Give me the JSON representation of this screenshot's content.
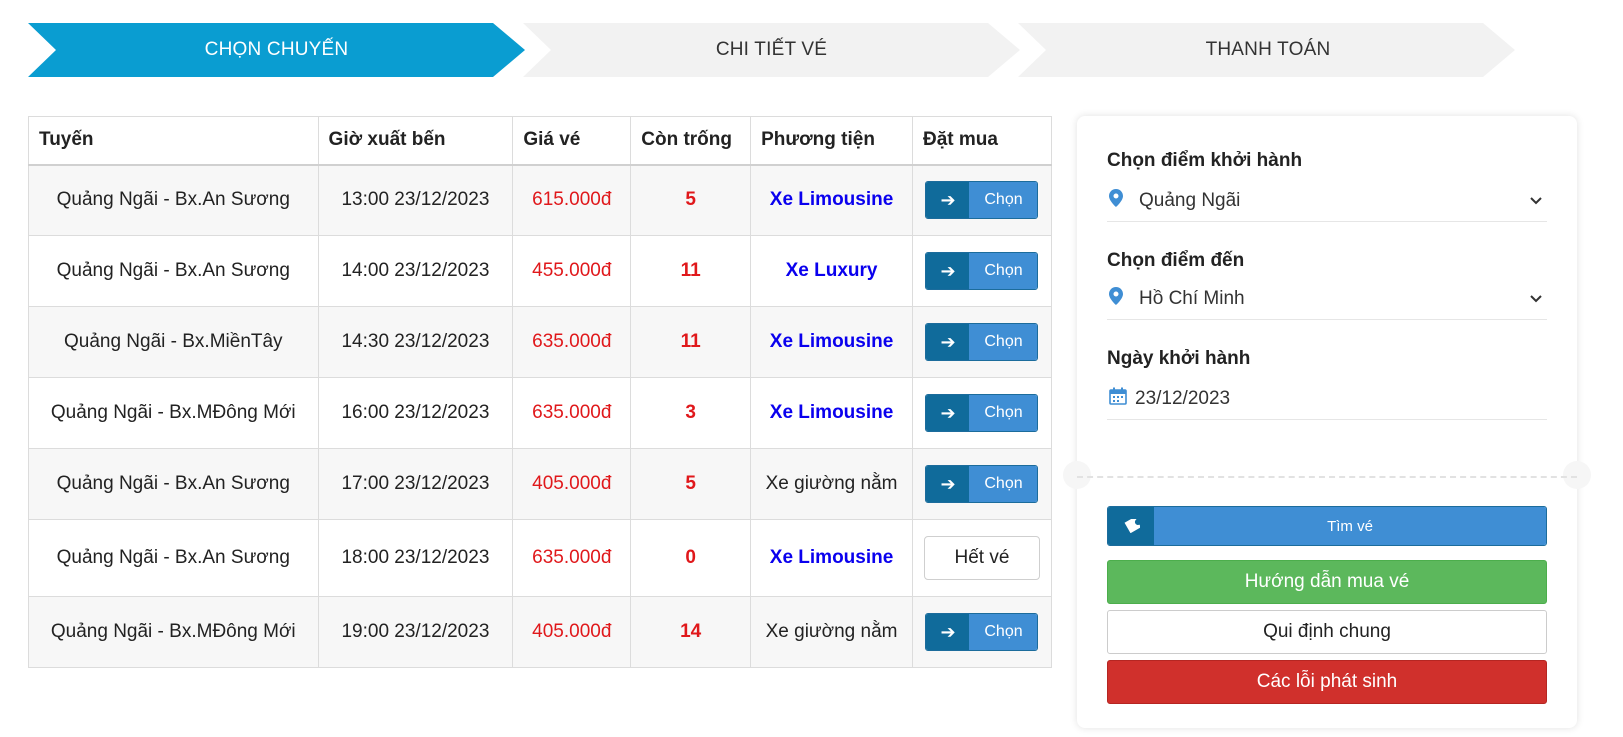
{
  "steps": [
    "CHỌN CHUYẾN",
    "CHI TIẾT VÉ",
    "THANH TOÁN"
  ],
  "table": {
    "headers": [
      "Tuyến",
      "Giờ xuất bến",
      "Giá vé",
      "Còn trống",
      "Phương tiện",
      "Đặt mua"
    ],
    "rows": [
      {
        "route": "Quảng Ngãi - Bx.An Sương",
        "time": "13:00 23/12/2023",
        "price": "615.000đ",
        "seats": "5",
        "vehicle": "Xe Limousine",
        "action": "Chọn"
      },
      {
        "route": "Quảng Ngãi - Bx.An Sương",
        "time": "14:00 23/12/2023",
        "price": "455.000đ",
        "seats": "11",
        "vehicle": "Xe Luxury",
        "action": "Chọn"
      },
      {
        "route": "Quảng Ngãi - Bx.MiềnTây",
        "time": "14:30 23/12/2023",
        "price": "635.000đ",
        "seats": "11",
        "vehicle": "Xe Limousine",
        "action": "Chọn"
      },
      {
        "route": "Quảng Ngãi - Bx.MĐông Mới",
        "time": "16:00 23/12/2023",
        "price": "635.000đ",
        "seats": "3",
        "vehicle": "Xe Limousine",
        "action": "Chọn"
      },
      {
        "route": "Quảng Ngãi - Bx.An Sương",
        "time": "17:00 23/12/2023",
        "price": "405.000đ",
        "seats": "5",
        "vehicle": "Xe giường nằm",
        "action": "Chọn"
      },
      {
        "route": "Quảng Ngãi - Bx.An Sương",
        "time": "18:00 23/12/2023",
        "price": "635.000đ",
        "seats": "0",
        "vehicle": "Xe Limousine",
        "action": "Hết vé"
      },
      {
        "route": "Quảng Ngãi - Bx.MĐông Mới",
        "time": "19:00 23/12/2023",
        "price": "405.000đ",
        "seats": "14",
        "vehicle": "Xe giường nằm",
        "action": "Chọn"
      }
    ]
  },
  "panel": {
    "departure_label": "Chọn điểm khởi hành",
    "departure_value": "Quảng Ngãi",
    "destination_label": "Chọn điểm đến",
    "destination_value": "Hồ Chí Minh",
    "date_label": "Ngày khởi hành",
    "date_value": "23/12/2023",
    "search_label": "Tìm vé",
    "guide_label": "Hướng dẫn mua vé",
    "rules_label": "Qui định chung",
    "errors_label": "Các lỗi phát sinh"
  },
  "icons": {
    "arrow": "arrow-right-icon",
    "pin": "map-pin-icon",
    "calendar": "calendar-icon",
    "ticket": "ticket-icon",
    "chevron": "chevron-down-icon"
  },
  "colors": {
    "step_active": "#0a9dd1",
    "button_blue": "#3f8ed4",
    "button_dark": "#106b9b",
    "price_red": "#e0181b",
    "vehicle_blue": "#0a00ee",
    "green": "#5cb85c",
    "red": "#d0302c"
  }
}
